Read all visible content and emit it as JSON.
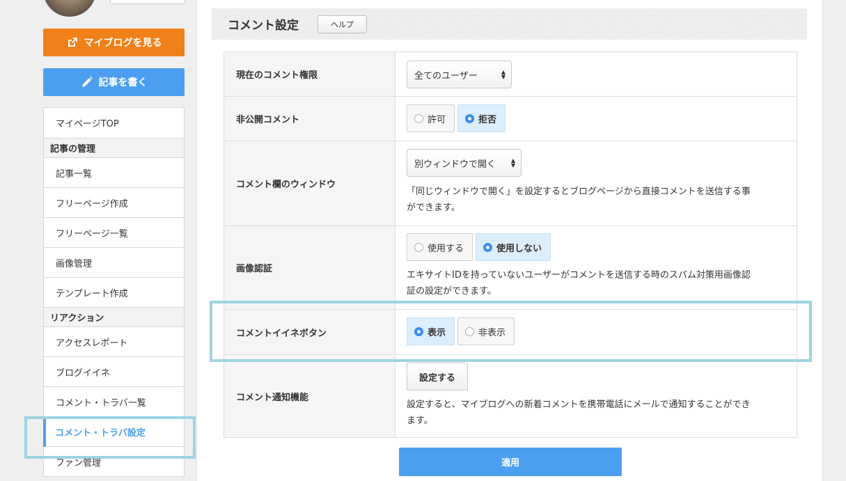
{
  "sidebar": {
    "view_blog_label": "マイブログを見る",
    "write_post_label": "記事を書く",
    "menu": [
      {
        "type": "item",
        "label": "マイページTOP"
      },
      {
        "type": "section",
        "label": "記事の管理"
      },
      {
        "type": "item",
        "label": "記事一覧"
      },
      {
        "type": "item",
        "label": "フリーページ作成"
      },
      {
        "type": "item",
        "label": "フリーページ一覧"
      },
      {
        "type": "item",
        "label": "画像管理"
      },
      {
        "type": "item",
        "label": "テンプレート作成"
      },
      {
        "type": "section",
        "label": "リアクション"
      },
      {
        "type": "item",
        "label": "アクセスレポート"
      },
      {
        "type": "item",
        "label": "ブログイイネ"
      },
      {
        "type": "item",
        "label": "コメント・トラバ一覧"
      },
      {
        "type": "item",
        "label": "コメント・トラバ設定",
        "active": true
      },
      {
        "type": "item",
        "label": "ファン管理"
      }
    ]
  },
  "main": {
    "section_title": "コメント設定",
    "help_label": "ヘルプ",
    "rows": {
      "permission": {
        "label": "現在のコメント権限",
        "selected": "全てのユーザー"
      },
      "private_comment": {
        "label": "非公開コメント",
        "options": [
          "許可",
          "拒否"
        ],
        "selected_index": 1
      },
      "comment_window": {
        "label": "コメント欄のウィンドウ",
        "selected": "別ウィンドウで開く",
        "description_line1": "「同じウィンドウで開く」を設定するとブログページから直接コメントを送信する事",
        "description_line2": "ができます。"
      },
      "captcha": {
        "label": "画像認証",
        "options": [
          "使用する",
          "使用しない"
        ],
        "selected_index": 1,
        "description_line1": "エキサイトIDを持っていないユーザーがコメントを送信する時のスパム対策用画像認",
        "description_line2": "証の設定ができます。"
      },
      "like_button": {
        "label": "コメントイイネボタン",
        "options": [
          "表示",
          "非表示"
        ],
        "selected_index": 0
      },
      "notification": {
        "label": "コメント通知機能",
        "button_label": "設定する",
        "description_line1": "設定すると、マイブログへの新着コメントを携帯電話にメールで通知することができ",
        "description_line2": "ます。"
      }
    },
    "apply_label": "適用"
  },
  "colors": {
    "orange": "#f08019",
    "blue": "#4c9ff0",
    "highlight": "#9fd3e2",
    "selected_bg": "#dcedfb"
  },
  "icons": {
    "view_blog": "external-link-icon",
    "write_post": "pencil-icon"
  }
}
